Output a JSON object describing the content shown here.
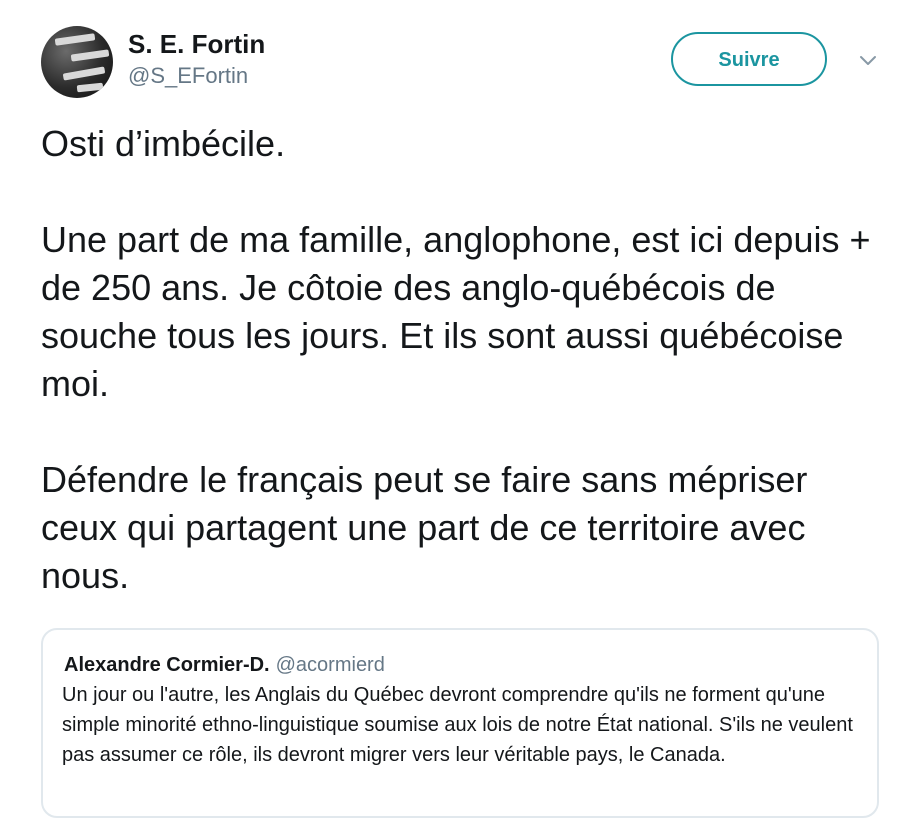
{
  "author": {
    "display_name": "S. E. Fortin",
    "handle": "@S_EFortin",
    "avatar_icon": "profile-photo"
  },
  "follow_button": {
    "label": "Suivre",
    "color": "#1b95a0"
  },
  "menu_icon": "chevron-down-icon",
  "tweet": {
    "paragraphs": [
      "Osti d’imbécile.",
      "Une part de ma famille, anglophone, est ici depuis + de 250 ans. Je côtoie des anglo-québécois de souche tous les jours. Et ils sont aussi québécoise moi.",
      "Défendre le français peut se faire sans mépriser ceux qui partagent une part de ce territoire avec nous."
    ]
  },
  "quoted_tweet": {
    "display_name": "Alexandre Cormier-D.",
    "handle": "@acormierd",
    "text": "Un jour ou l'autre, les Anglais du Québec devront comprendre qu'ils ne forment qu'une simple minorité ethno-linguistique soumise aux lois de notre État national. S'ils ne veulent pas assumer ce rôle, ils devront migrer vers leur véritable pays, le Canada."
  }
}
